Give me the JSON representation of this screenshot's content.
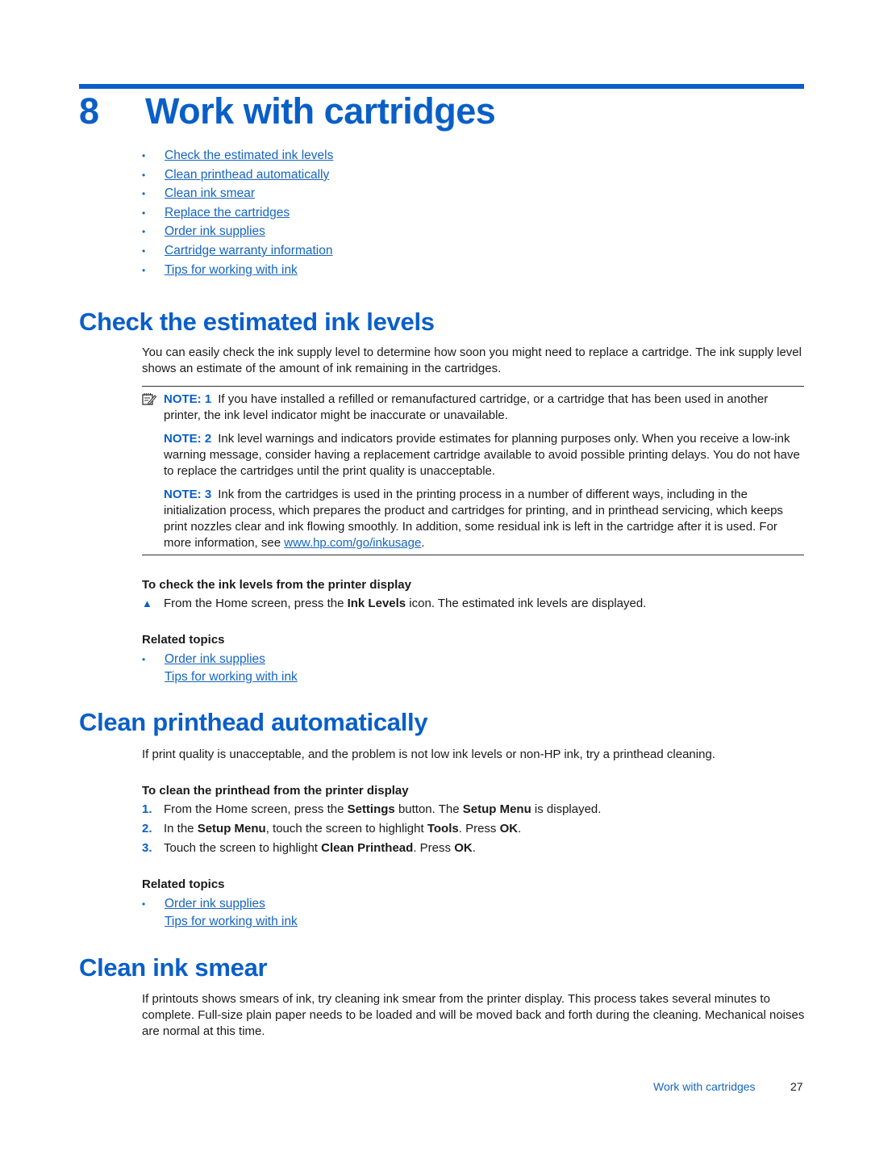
{
  "chapter": {
    "number": "8",
    "title": "Work with cartridges"
  },
  "toc": [
    "Check the estimated ink levels",
    "Clean printhead automatically",
    "Clean ink smear",
    "Replace the cartridges",
    "Order ink supplies",
    "Cartridge warranty information",
    "Tips for working with ink"
  ],
  "section1": {
    "title": "Check the estimated ink levels",
    "intro": "You can easily check the ink supply level to determine how soon you might need to replace a cartridge. The ink supply level shows an estimate of the amount of ink remaining in the cartridges.",
    "notes": [
      {
        "label": "NOTE: 1",
        "text": "If you have installed a refilled or remanufactured cartridge, or a cartridge that has been used in another printer, the ink level indicator might be inaccurate or unavailable."
      },
      {
        "label": "NOTE: 2",
        "text": "Ink level warnings and indicators provide estimates for planning purposes only. When you receive a low-ink warning message, consider having a replacement cartridge available to avoid possible printing delays. You do not have to replace the cartridges until the print quality is unacceptable."
      },
      {
        "label": "NOTE: 3",
        "text_before": "Ink from the cartridges is used in the printing process in a number of different ways, including in the initialization process, which prepares the product and cartridges for printing, and in printhead servicing, which keeps print nozzles clear and ink flowing smoothly. In addition, some residual ink is left in the cartridge after it is used. For more information, see ",
        "link": "www.hp.com/go/inkusage",
        "text_after": "."
      }
    ],
    "procedure_title": "To check the ink levels from the printer display",
    "step": {
      "before": "From the Home screen, press the ",
      "bold": "Ink Levels",
      "after": " icon. The estimated ink levels are displayed."
    },
    "related_title": "Related topics",
    "related": [
      "Order ink supplies",
      "Tips for working with ink"
    ]
  },
  "section2": {
    "title": "Clean printhead automatically",
    "intro": "If print quality is unacceptable, and the problem is not low ink levels or non-HP ink, try a printhead cleaning.",
    "procedure_title": "To clean the printhead from the printer display",
    "steps": [
      {
        "n": "1.",
        "parts": [
          "From the Home screen, press the ",
          "Settings",
          " button. The ",
          "Setup Menu",
          " is displayed."
        ]
      },
      {
        "n": "2.",
        "parts": [
          "In the ",
          "Setup Menu",
          ", touch the screen to highlight ",
          "Tools",
          ". Press ",
          "OK",
          "."
        ]
      },
      {
        "n": "3.",
        "parts": [
          "Touch the screen to highlight ",
          "Clean Printhead",
          ". Press ",
          "OK",
          "."
        ]
      }
    ],
    "related_title": "Related topics",
    "related": [
      "Order ink supplies",
      "Tips for working with ink"
    ]
  },
  "section3": {
    "title": "Clean ink smear",
    "intro": "If printouts shows smears of ink, try cleaning ink smear from the printer display. This process takes several minutes to complete. Full-size plain paper needs to be loaded and will be moved back and forth during the cleaning. Mechanical noises are normal at this time."
  },
  "footer": {
    "section": "Work with cartridges",
    "page": "27"
  },
  "colors": {
    "accent": "#0a5fc7",
    "link": "#1565c0"
  }
}
